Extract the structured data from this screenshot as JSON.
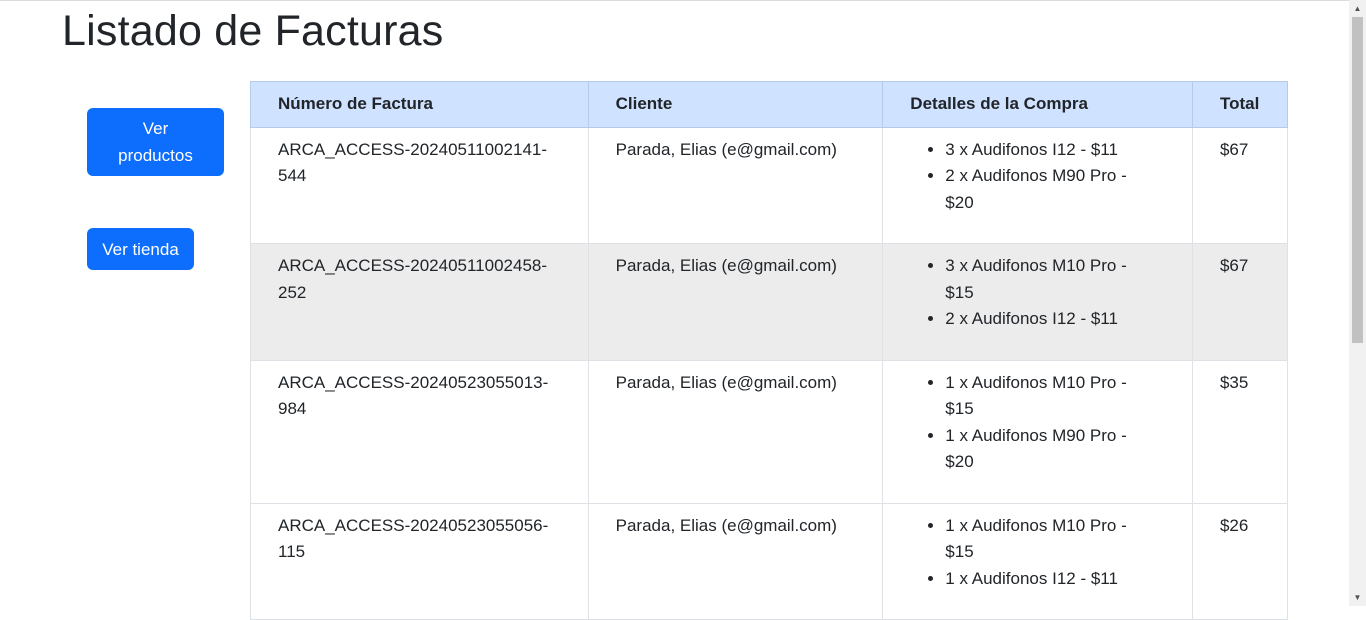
{
  "page": {
    "title": "Listado de Facturas"
  },
  "sidebar": {
    "ver_productos": "Ver productos",
    "ver_tienda": "Ver tienda"
  },
  "table": {
    "headers": [
      "Número de Factura",
      "Cliente",
      "Detalles de la Compra",
      "Total"
    ],
    "rows": [
      {
        "numero": "ARCA_ACCESS-20240511002141-544",
        "cliente": "Parada, Elias (e@gmail.com)",
        "detalles": [
          "3 x Audifonos I12 - $11",
          "2 x Audifonos M90 Pro - $20"
        ],
        "total": "$67"
      },
      {
        "numero": "ARCA_ACCESS-20240511002458-252",
        "cliente": "Parada, Elias (e@gmail.com)",
        "detalles": [
          "3 x Audifonos M10 Pro - $15",
          "2 x Audifonos I12 - $11"
        ],
        "total": "$67"
      },
      {
        "numero": "ARCA_ACCESS-20240523055013-984",
        "cliente": "Parada, Elias (e@gmail.com)",
        "detalles": [
          "1 x Audifonos M10 Pro - $15",
          "1 x Audifonos M90 Pro - $20"
        ],
        "total": "$35"
      },
      {
        "numero": "ARCA_ACCESS-20240523055056-115",
        "cliente": "Parada, Elias (e@gmail.com)",
        "detalles": [
          "1 x Audifonos M10 Pro - $15",
          "1 x Audifonos I12 - $11"
        ],
        "total": "$26"
      }
    ]
  },
  "colors": {
    "primary_button": "#0d6efd",
    "header_background": "#cfe2ff",
    "striped_row": "#ececec"
  },
  "icons": {
    "scroll_up": "triangle-up-icon",
    "scroll_down": "triangle-down-icon"
  }
}
